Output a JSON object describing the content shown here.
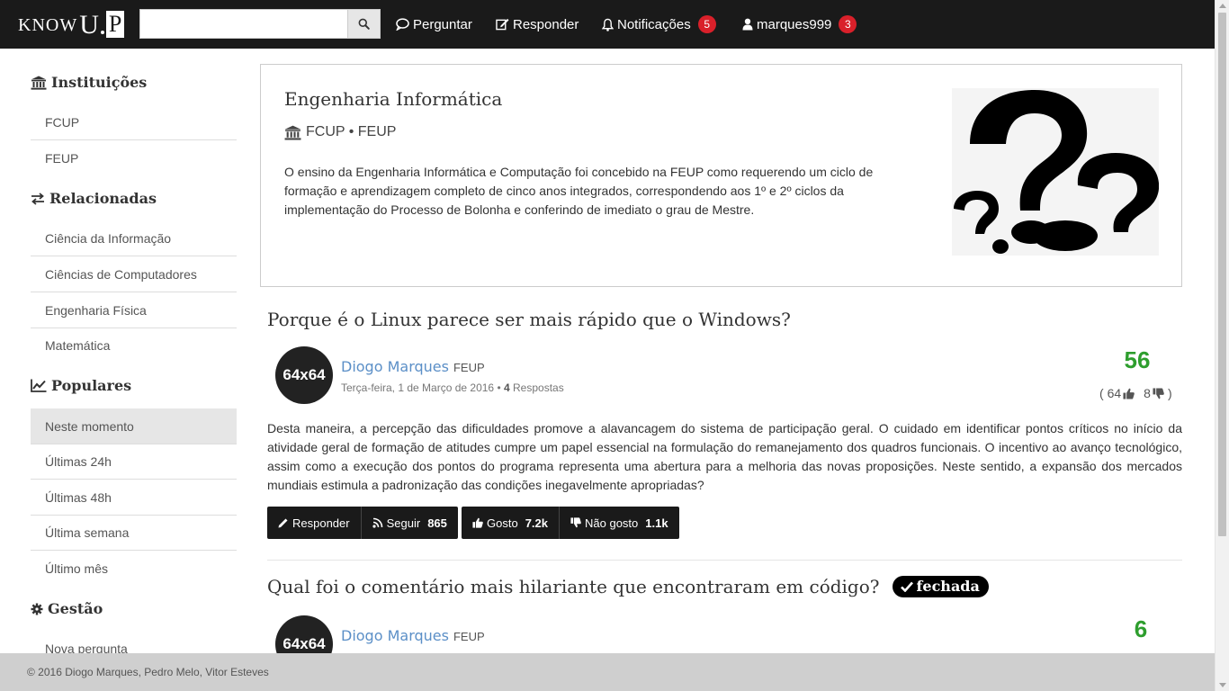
{
  "navbar": {
    "brand": {
      "know": "KNOW",
      "u": "U",
      "p": "P"
    },
    "search": {
      "placeholder": "",
      "value": ""
    },
    "links": [
      {
        "label": "Perguntar",
        "icon": "comment-icon"
      },
      {
        "label": "Responder",
        "icon": "edit-icon"
      },
      {
        "label": "Notificações",
        "icon": "bell-icon",
        "badge": "5"
      },
      {
        "label": "marques999",
        "icon": "user-icon",
        "badge": "3"
      }
    ]
  },
  "sidebar": {
    "institutions": {
      "title": "Instituições",
      "items": [
        "FCUP",
        "FEUP"
      ]
    },
    "related": {
      "title": "Relacionadas",
      "items": [
        "Ciência da Informação",
        "Ciências de Computadores",
        "Engenharia Física",
        "Matemática"
      ]
    },
    "popular": {
      "title": "Populares",
      "items": [
        "Neste momento",
        "Últimas 24h",
        "Últimas 48h",
        "Última semana",
        "Último mês"
      ],
      "active": "Neste momento"
    },
    "management": {
      "title": "Gestão",
      "items": [
        "Nova pergunta"
      ]
    }
  },
  "course": {
    "title": "Engenharia Informática",
    "institutions": "FCUP • FEUP",
    "description": "O ensino da Engenharia Informática e Computação foi concebido na FEUP como requerendo um ciclo de formação e aprendizagem completo de cinco anos integrados, correspondendo aos 1º e 2º ciclos da implementação do Processo de Bolonha e conferindo de imediato o grau de Mestre."
  },
  "questions": [
    {
      "title": "Porque é o Linux parece ser mais rápido que o Windows?",
      "avatar": "64x64",
      "author": "Diogo Marques",
      "author_inst": "FEUP",
      "date": "Terça-feira, 1 de Março de 2016",
      "answers_count": "4",
      "answers_label": "Respostas",
      "score": "56",
      "upvotes": "64",
      "downvotes": "8",
      "body": "Desta maneira, a percepção das dificuldades promove a alavancagem do sistema de participação geral. O cuidado em identificar pontos críticos no início da atividade geral de formação de atitudes cumpre um papel essencial na formulação do remanejamento dos quadros funcionais. O incentivo ao avanço tecnológico, assim como a execução dos pontos do programa representa uma abertura para a melhoria das novas proposições. Neste sentido, a expansão dos mercados mundiais estimula a padronização das condições inegavelmente apropriadas?",
      "buttons": {
        "answer": "Responder",
        "follow": "Seguir",
        "follow_count": "865",
        "like": "Gosto",
        "like_count": "7.2k",
        "dislike": "Não gosto",
        "dislike_count": "1.1k"
      }
    },
    {
      "title": "Qual foi o comentário mais hilariante que encontraram em código?",
      "closed_label": "fechada",
      "avatar": "64x64",
      "author": "Diogo Marques",
      "author_inst": "FEUP",
      "score": "6"
    }
  ],
  "footer": {
    "text": "© 2016 Diogo Marques, Pedro Melo, Vitor Esteves"
  },
  "colors": {
    "navbar": "#1a1a1a",
    "badge": "#d9202a",
    "score": "#2e9e2e",
    "author": "#5b8fc7",
    "footer": "#cfcfcf"
  }
}
